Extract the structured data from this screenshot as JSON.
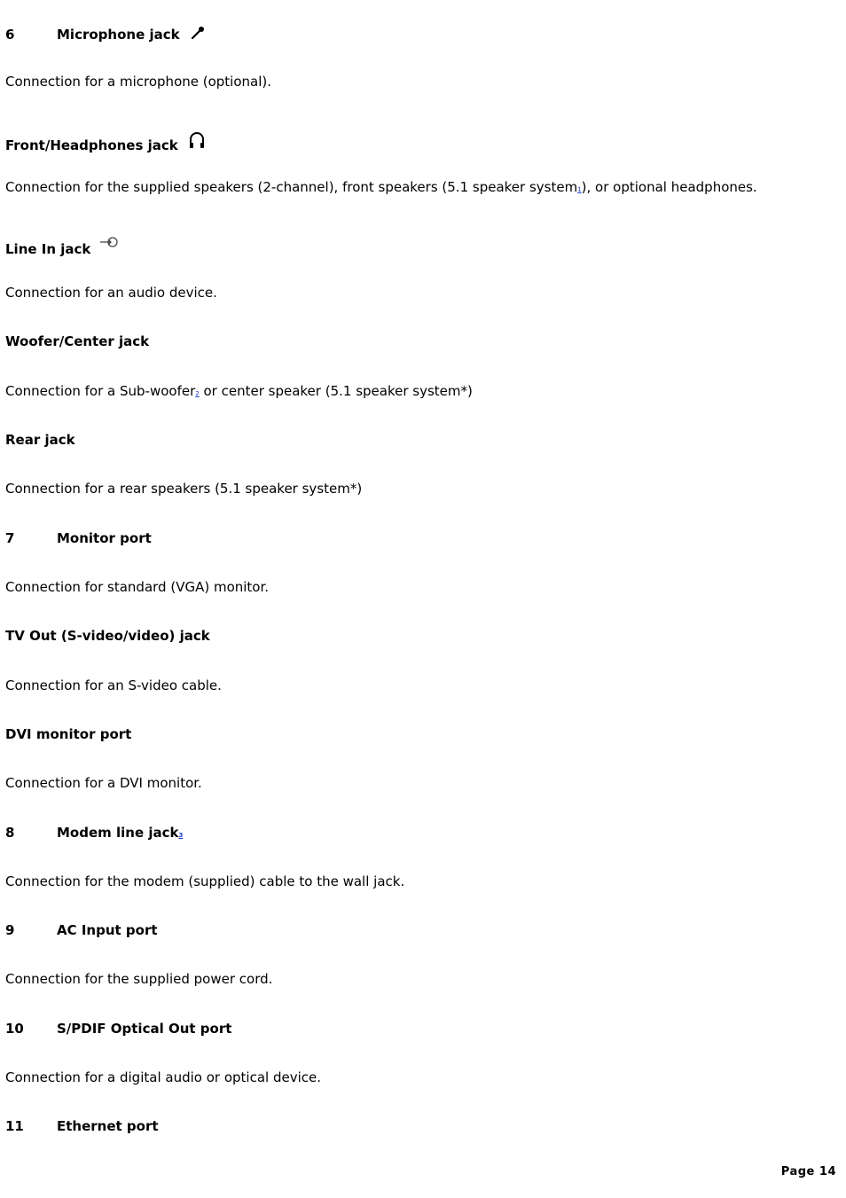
{
  "items": [
    {
      "num": "6",
      "title": "Microphone jack",
      "icon": "microphone-icon",
      "desc": "Connection for a microphone (optional)."
    },
    {
      "title": "Front/Headphones jack",
      "icon": "headphones-icon",
      "desc_before": "Connection for the supplied speakers (2-channel), front speakers (5.1 speaker system",
      "footnote": "1",
      "desc_after": "), or optional headphones."
    },
    {
      "title": "Line In jack",
      "icon": "line-in-icon",
      "desc": "Connection for an audio device."
    },
    {
      "title": "Woofer/Center jack",
      "desc_before": "Connection for a Sub-woofer",
      "footnote": "2",
      "desc_after": " or center speaker (5.1 speaker system*)"
    },
    {
      "title": "Rear jack",
      "desc": "Connection for a rear speakers (5.1 speaker system*)"
    },
    {
      "num": "7",
      "title": "Monitor port",
      "desc": "Connection for standard (VGA) monitor."
    },
    {
      "title": "TV Out (S-video/video) jack",
      "desc": "Connection for an S-video cable."
    },
    {
      "title": "DVI monitor port",
      "desc": "Connection for a DVI monitor."
    },
    {
      "num": "8",
      "title": "Modem line jack",
      "footnote": "3",
      "desc": "Connection for the modem (supplied) cable to the wall jack."
    },
    {
      "num": "9",
      "title": "AC Input port",
      "desc": "Connection for the supplied power cord."
    },
    {
      "num": "10",
      "title": "S/PDIF Optical Out port",
      "desc": "Connection for a digital audio or optical device."
    },
    {
      "num": "11",
      "title": "Ethernet port"
    }
  ],
  "footer": {
    "page_label": "Page 14"
  }
}
